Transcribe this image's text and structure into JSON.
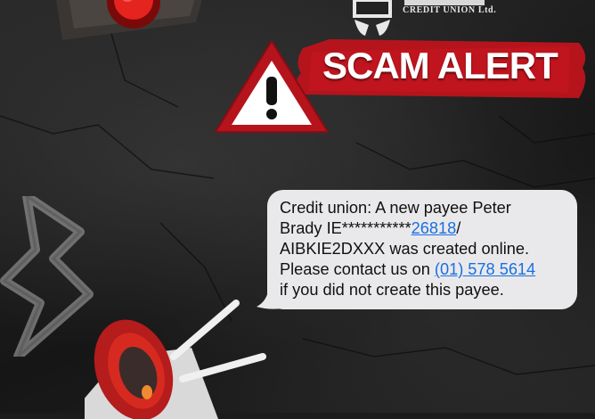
{
  "logo": {
    "org_name": "CREDIT UNION Ltd."
  },
  "alert": {
    "title": "SCAM ALERT"
  },
  "message": {
    "line1": "Credit union: A new payee Peter",
    "line2_prefix": "Brady IE***********",
    "line2_link": "26818",
    "line2_suffix": "/",
    "line3": "AIBKIE2DXXX was created online.",
    "line4_prefix": "Please contact us on ",
    "line4_link": "(01) 578 5614",
    "line5": "if you did not create this payee."
  },
  "colors": {
    "alert_red": "#b5141c",
    "link_blue": "#1a6fe0",
    "bubble_gray": "#e9e9eb"
  }
}
